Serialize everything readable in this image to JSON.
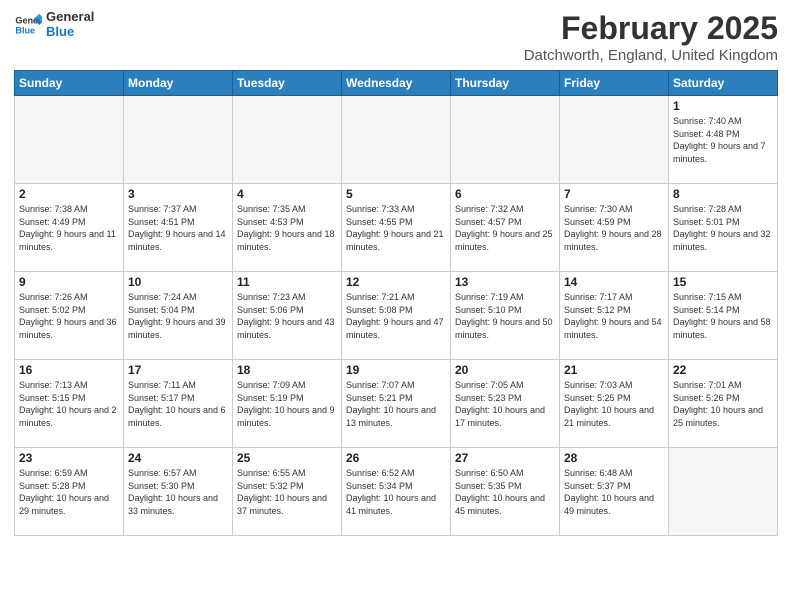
{
  "logo": {
    "general": "General",
    "blue": "Blue"
  },
  "header": {
    "title": "February 2025",
    "subtitle": "Datchworth, England, United Kingdom"
  },
  "weekdays": [
    "Sunday",
    "Monday",
    "Tuesday",
    "Wednesday",
    "Thursday",
    "Friday",
    "Saturday"
  ],
  "weeks": [
    [
      {
        "day": "",
        "info": ""
      },
      {
        "day": "",
        "info": ""
      },
      {
        "day": "",
        "info": ""
      },
      {
        "day": "",
        "info": ""
      },
      {
        "day": "",
        "info": ""
      },
      {
        "day": "",
        "info": ""
      },
      {
        "day": "1",
        "info": "Sunrise: 7:40 AM\nSunset: 4:48 PM\nDaylight: 9 hours and 7 minutes."
      }
    ],
    [
      {
        "day": "2",
        "info": "Sunrise: 7:38 AM\nSunset: 4:49 PM\nDaylight: 9 hours and 11 minutes."
      },
      {
        "day": "3",
        "info": "Sunrise: 7:37 AM\nSunset: 4:51 PM\nDaylight: 9 hours and 14 minutes."
      },
      {
        "day": "4",
        "info": "Sunrise: 7:35 AM\nSunset: 4:53 PM\nDaylight: 9 hours and 18 minutes."
      },
      {
        "day": "5",
        "info": "Sunrise: 7:33 AM\nSunset: 4:55 PM\nDaylight: 9 hours and 21 minutes."
      },
      {
        "day": "6",
        "info": "Sunrise: 7:32 AM\nSunset: 4:57 PM\nDaylight: 9 hours and 25 minutes."
      },
      {
        "day": "7",
        "info": "Sunrise: 7:30 AM\nSunset: 4:59 PM\nDaylight: 9 hours and 28 minutes."
      },
      {
        "day": "8",
        "info": "Sunrise: 7:28 AM\nSunset: 5:01 PM\nDaylight: 9 hours and 32 minutes."
      }
    ],
    [
      {
        "day": "9",
        "info": "Sunrise: 7:26 AM\nSunset: 5:02 PM\nDaylight: 9 hours and 36 minutes."
      },
      {
        "day": "10",
        "info": "Sunrise: 7:24 AM\nSunset: 5:04 PM\nDaylight: 9 hours and 39 minutes."
      },
      {
        "day": "11",
        "info": "Sunrise: 7:23 AM\nSunset: 5:06 PM\nDaylight: 9 hours and 43 minutes."
      },
      {
        "day": "12",
        "info": "Sunrise: 7:21 AM\nSunset: 5:08 PM\nDaylight: 9 hours and 47 minutes."
      },
      {
        "day": "13",
        "info": "Sunrise: 7:19 AM\nSunset: 5:10 PM\nDaylight: 9 hours and 50 minutes."
      },
      {
        "day": "14",
        "info": "Sunrise: 7:17 AM\nSunset: 5:12 PM\nDaylight: 9 hours and 54 minutes."
      },
      {
        "day": "15",
        "info": "Sunrise: 7:15 AM\nSunset: 5:14 PM\nDaylight: 9 hours and 58 minutes."
      }
    ],
    [
      {
        "day": "16",
        "info": "Sunrise: 7:13 AM\nSunset: 5:15 PM\nDaylight: 10 hours and 2 minutes."
      },
      {
        "day": "17",
        "info": "Sunrise: 7:11 AM\nSunset: 5:17 PM\nDaylight: 10 hours and 6 minutes."
      },
      {
        "day": "18",
        "info": "Sunrise: 7:09 AM\nSunset: 5:19 PM\nDaylight: 10 hours and 9 minutes."
      },
      {
        "day": "19",
        "info": "Sunrise: 7:07 AM\nSunset: 5:21 PM\nDaylight: 10 hours and 13 minutes."
      },
      {
        "day": "20",
        "info": "Sunrise: 7:05 AM\nSunset: 5:23 PM\nDaylight: 10 hours and 17 minutes."
      },
      {
        "day": "21",
        "info": "Sunrise: 7:03 AM\nSunset: 5:25 PM\nDaylight: 10 hours and 21 minutes."
      },
      {
        "day": "22",
        "info": "Sunrise: 7:01 AM\nSunset: 5:26 PM\nDaylight: 10 hours and 25 minutes."
      }
    ],
    [
      {
        "day": "23",
        "info": "Sunrise: 6:59 AM\nSunset: 5:28 PM\nDaylight: 10 hours and 29 minutes."
      },
      {
        "day": "24",
        "info": "Sunrise: 6:57 AM\nSunset: 5:30 PM\nDaylight: 10 hours and 33 minutes."
      },
      {
        "day": "25",
        "info": "Sunrise: 6:55 AM\nSunset: 5:32 PM\nDaylight: 10 hours and 37 minutes."
      },
      {
        "day": "26",
        "info": "Sunrise: 6:52 AM\nSunset: 5:34 PM\nDaylight: 10 hours and 41 minutes."
      },
      {
        "day": "27",
        "info": "Sunrise: 6:50 AM\nSunset: 5:35 PM\nDaylight: 10 hours and 45 minutes."
      },
      {
        "day": "28",
        "info": "Sunrise: 6:48 AM\nSunset: 5:37 PM\nDaylight: 10 hours and 49 minutes."
      },
      {
        "day": "",
        "info": ""
      }
    ]
  ]
}
